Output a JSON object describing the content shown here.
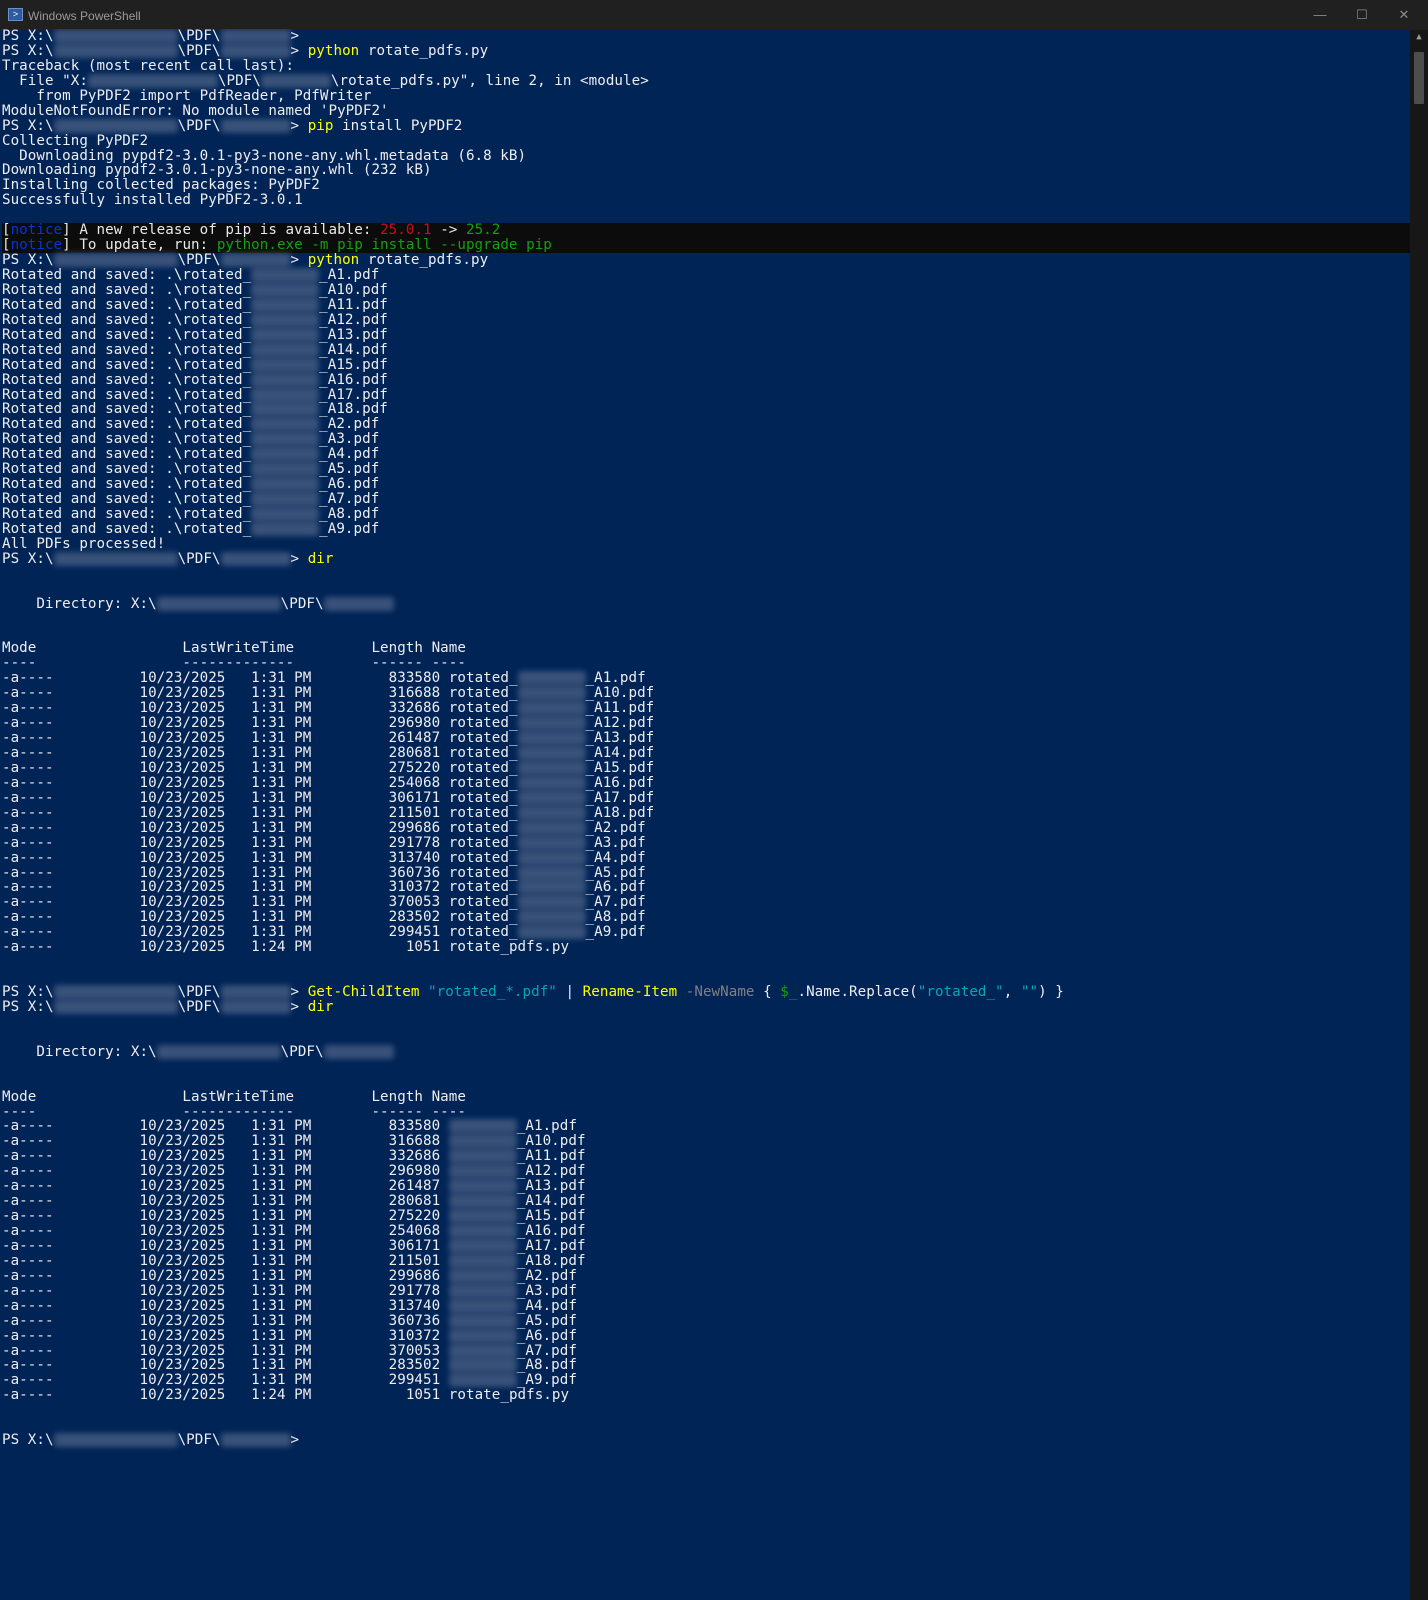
{
  "window": {
    "title": "Windows PowerShell",
    "icon": "powershell-icon",
    "controls": {
      "minimize": "—",
      "maximize": "☐",
      "close": "✕"
    }
  },
  "text": {
    "ps": "PS X:\\",
    "pdf": "\\PDF\\",
    "prompt_end": ">",
    "python": "python",
    "script": "rotate_pdfs.py",
    "pip": "pip",
    "pip_args": "install PyPDF2",
    "tb_header": "Traceback (most recent call last):",
    "tb_file_start": "  File \"X:",
    "tb_file_mid": "\\PDF\\",
    "tb_file_end": "\\rotate_pdfs.py\", line 2, in <module>",
    "tb_code": "    from PyPDF2 import PdfReader, PdfWriter",
    "tb_error": "ModuleNotFoundError: No module named 'PyPDF2'",
    "collecting": "Collecting PyPDF2",
    "dl1": "  Downloading pypdf2-3.0.1-py3-none-any.whl.metadata (6.8 kB)",
    "dl2": "Downloading pypdf2-3.0.1-py3-none-any.whl (232 kB)",
    "installing": "Installing collected packages: PyPDF2",
    "success": "Successfully installed PyPDF2-3.0.1",
    "notice_open": "[",
    "notice_word": "notice",
    "notice_close": "]",
    "notice1_text": " A new release of pip is available: ",
    "notice1_old": "25.0.1",
    "notice1_arrow": " -> ",
    "notice1_new": "25.2",
    "notice2_text": " To update, run: ",
    "notice2_cmd": "python.exe -m pip install --upgrade pip",
    "rotated_prefix": "Rotated and saved: .\\rotated_",
    "all_done": "All PDFs processed!",
    "dir_cmd": "dir",
    "directory_label": "    Directory: X:\\",
    "directory_mid": "\\PDF\\",
    "table_header": "Mode                 LastWriteTime         Length Name",
    "table_sep": "----                 -------------         ------ ----",
    "gci": "Get-ChildItem",
    "gci_arg": "\"rotated_*.pdf\"",
    "pipe": " | ",
    "rename": "Rename-Item",
    "newname": "-NewName",
    "brace_open": " { ",
    "var": "$_",
    "replace_call": ".Name.Replace(",
    "str1": "\"rotated_\"",
    "comma": ", ",
    "str2": "\"\"",
    "brace_close": ") }",
    "rotated_name": "rotated_"
  },
  "rotated_suffixes": [
    "_A1.pdf",
    "_A10.pdf",
    "_A11.pdf",
    "_A12.pdf",
    "_A13.pdf",
    "_A14.pdf",
    "_A15.pdf",
    "_A16.pdf",
    "_A17.pdf",
    "_A18.pdf",
    "_A2.pdf",
    "_A3.pdf",
    "_A4.pdf",
    "_A5.pdf",
    "_A6.pdf",
    "_A7.pdf",
    "_A8.pdf",
    "_A9.pdf"
  ],
  "listing1": {
    "rows": [
      {
        "mode": "-a----",
        "date": "10/23/2025",
        "time": "1:31 PM",
        "length": "833580",
        "name_suffix": "_A1.pdf"
      },
      {
        "mode": "-a----",
        "date": "10/23/2025",
        "time": "1:31 PM",
        "length": "316688",
        "name_suffix": "_A10.pdf"
      },
      {
        "mode": "-a----",
        "date": "10/23/2025",
        "time": "1:31 PM",
        "length": "332686",
        "name_suffix": "_A11.pdf"
      },
      {
        "mode": "-a----",
        "date": "10/23/2025",
        "time": "1:31 PM",
        "length": "296980",
        "name_suffix": "_A12.pdf"
      },
      {
        "mode": "-a----",
        "date": "10/23/2025",
        "time": "1:31 PM",
        "length": "261487",
        "name_suffix": "_A13.pdf"
      },
      {
        "mode": "-a----",
        "date": "10/23/2025",
        "time": "1:31 PM",
        "length": "280681",
        "name_suffix": "_A14.pdf"
      },
      {
        "mode": "-a----",
        "date": "10/23/2025",
        "time": "1:31 PM",
        "length": "275220",
        "name_suffix": "_A15.pdf"
      },
      {
        "mode": "-a----",
        "date": "10/23/2025",
        "time": "1:31 PM",
        "length": "254068",
        "name_suffix": "_A16.pdf"
      },
      {
        "mode": "-a----",
        "date": "10/23/2025",
        "time": "1:31 PM",
        "length": "306171",
        "name_suffix": "_A17.pdf"
      },
      {
        "mode": "-a----",
        "date": "10/23/2025",
        "time": "1:31 PM",
        "length": "211501",
        "name_suffix": "_A18.pdf"
      },
      {
        "mode": "-a----",
        "date": "10/23/2025",
        "time": "1:31 PM",
        "length": "299686",
        "name_suffix": "_A2.pdf"
      },
      {
        "mode": "-a----",
        "date": "10/23/2025",
        "time": "1:31 PM",
        "length": "291778",
        "name_suffix": "_A3.pdf"
      },
      {
        "mode": "-a----",
        "date": "10/23/2025",
        "time": "1:31 PM",
        "length": "313740",
        "name_suffix": "_A4.pdf"
      },
      {
        "mode": "-a----",
        "date": "10/23/2025",
        "time": "1:31 PM",
        "length": "360736",
        "name_suffix": "_A5.pdf"
      },
      {
        "mode": "-a----",
        "date": "10/23/2025",
        "time": "1:31 PM",
        "length": "310372",
        "name_suffix": "_A6.pdf"
      },
      {
        "mode": "-a----",
        "date": "10/23/2025",
        "time": "1:31 PM",
        "length": "370053",
        "name_suffix": "_A7.pdf"
      },
      {
        "mode": "-a----",
        "date": "10/23/2025",
        "time": "1:31 PM",
        "length": "283502",
        "name_suffix": "_A8.pdf"
      },
      {
        "mode": "-a----",
        "date": "10/23/2025",
        "time": "1:31 PM",
        "length": "299451",
        "name_suffix": "_A9.pdf"
      }
    ],
    "script_row": {
      "mode": "-a----",
      "date": "10/23/2025",
      "time": "1:24 PM",
      "length": "1051",
      "name": "rotate_pdfs.py"
    }
  },
  "listing2": {
    "rows": [
      {
        "mode": "-a----",
        "date": "10/23/2025",
        "time": "1:31 PM",
        "length": "833580",
        "name_suffix": "_A1.pdf"
      },
      {
        "mode": "-a----",
        "date": "10/23/2025",
        "time": "1:31 PM",
        "length": "316688",
        "name_suffix": "_A10.pdf"
      },
      {
        "mode": "-a----",
        "date": "10/23/2025",
        "time": "1:31 PM",
        "length": "332686",
        "name_suffix": "_A11.pdf"
      },
      {
        "mode": "-a----",
        "date": "10/23/2025",
        "time": "1:31 PM",
        "length": "296980",
        "name_suffix": "_A12.pdf"
      },
      {
        "mode": "-a----",
        "date": "10/23/2025",
        "time": "1:31 PM",
        "length": "261487",
        "name_suffix": "_A13.pdf"
      },
      {
        "mode": "-a----",
        "date": "10/23/2025",
        "time": "1:31 PM",
        "length": "280681",
        "name_suffix": "_A14.pdf"
      },
      {
        "mode": "-a----",
        "date": "10/23/2025",
        "time": "1:31 PM",
        "length": "275220",
        "name_suffix": "_A15.pdf"
      },
      {
        "mode": "-a----",
        "date": "10/23/2025",
        "time": "1:31 PM",
        "length": "254068",
        "name_suffix": "_A16.pdf"
      },
      {
        "mode": "-a----",
        "date": "10/23/2025",
        "time": "1:31 PM",
        "length": "306171",
        "name_suffix": "_A17.pdf"
      },
      {
        "mode": "-a----",
        "date": "10/23/2025",
        "time": "1:31 PM",
        "length": "211501",
        "name_suffix": "_A18.pdf"
      },
      {
        "mode": "-a----",
        "date": "10/23/2025",
        "time": "1:31 PM",
        "length": "299686",
        "name_suffix": "_A2.pdf"
      },
      {
        "mode": "-a----",
        "date": "10/23/2025",
        "time": "1:31 PM",
        "length": "291778",
        "name_suffix": "_A3.pdf"
      },
      {
        "mode": "-a----",
        "date": "10/23/2025",
        "time": "1:31 PM",
        "length": "313740",
        "name_suffix": "_A4.pdf"
      },
      {
        "mode": "-a----",
        "date": "10/23/2025",
        "time": "1:31 PM",
        "length": "360736",
        "name_suffix": "_A5.pdf"
      },
      {
        "mode": "-a----",
        "date": "10/23/2025",
        "time": "1:31 PM",
        "length": "310372",
        "name_suffix": "_A6.pdf"
      },
      {
        "mode": "-a----",
        "date": "10/23/2025",
        "time": "1:31 PM",
        "length": "370053",
        "name_suffix": "_A7.pdf"
      },
      {
        "mode": "-a----",
        "date": "10/23/2025",
        "time": "1:31 PM",
        "length": "283502",
        "name_suffix": "_A8.pdf"
      },
      {
        "mode": "-a----",
        "date": "10/23/2025",
        "time": "1:31 PM",
        "length": "299451",
        "name_suffix": "_A9.pdf"
      }
    ],
    "script_row": {
      "mode": "-a----",
      "date": "10/23/2025",
      "time": "1:24 PM",
      "length": "1051",
      "name": "rotate_pdfs.py"
    }
  },
  "colors": {
    "background": "#012456",
    "foreground": "#eeedf0",
    "command": "#ffff00",
    "string": "#00aaaa",
    "parameter": "#808080",
    "notice_bg": "#0c0c0c",
    "notice_word": "#0037da",
    "version_old": "#c50f1f",
    "version_new": "#13a10e"
  }
}
